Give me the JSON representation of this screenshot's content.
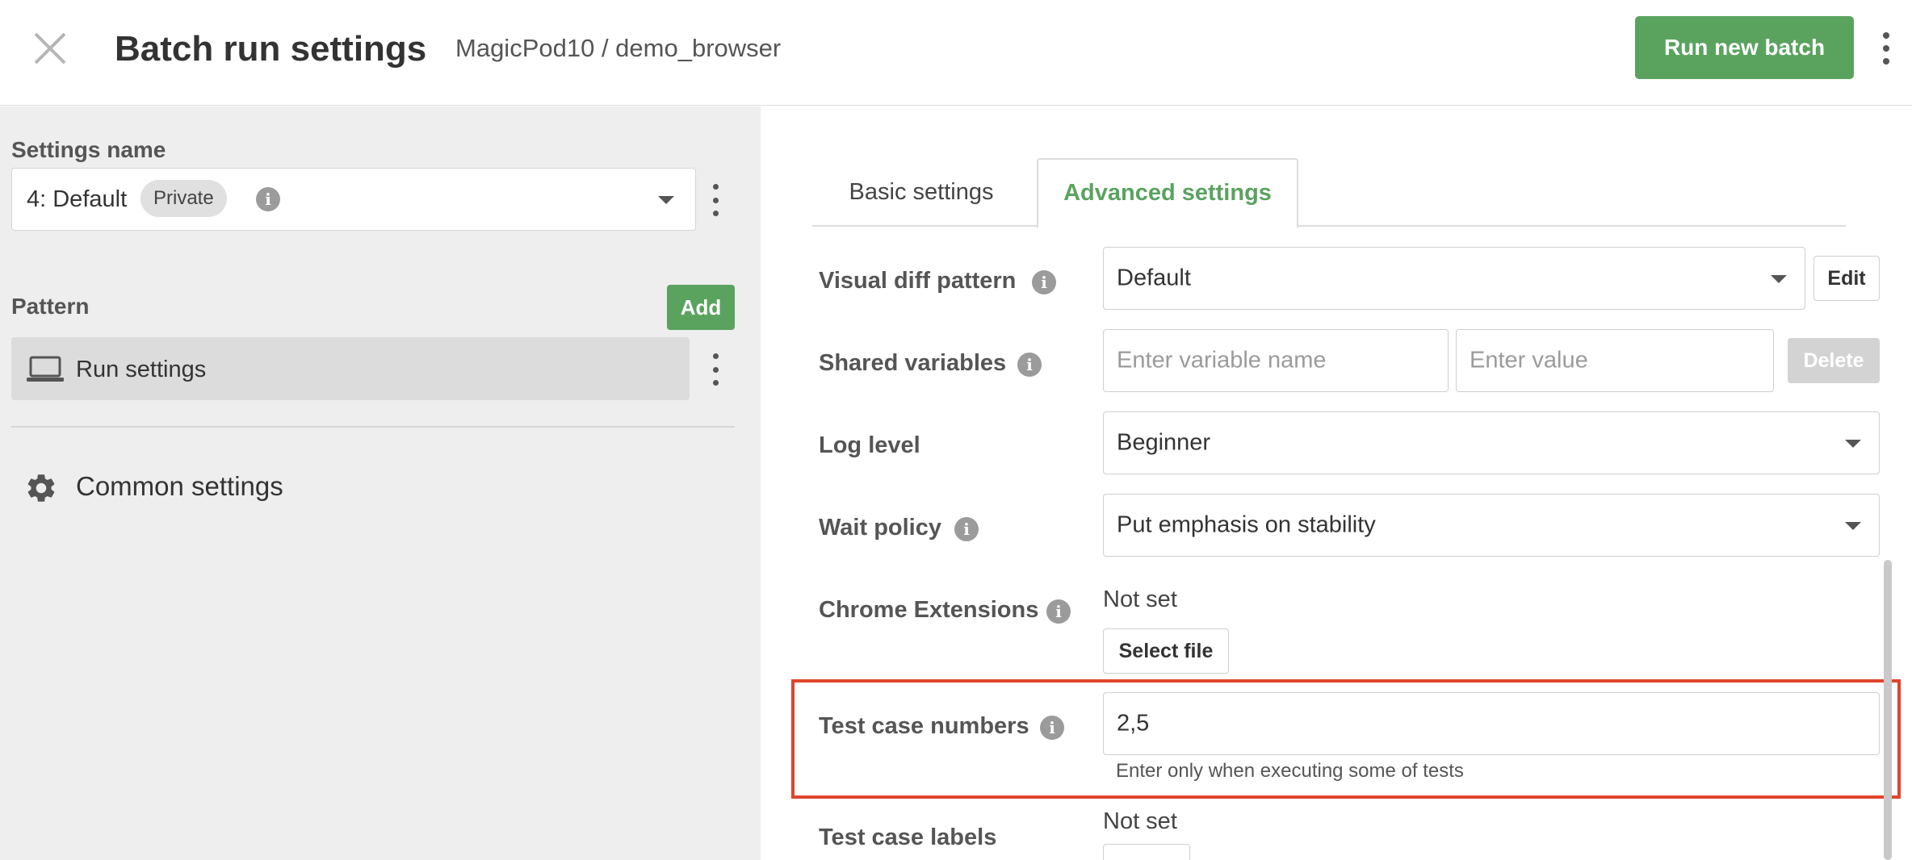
{
  "header": {
    "title": "Batch run settings",
    "breadcrumb": "MagicPod10 / demo_browser",
    "run_button": "Run new batch"
  },
  "sidebar": {
    "settings_name_label": "Settings name",
    "selected_setting": "4: Default",
    "visibility_badge": "Private",
    "pattern_label": "Pattern",
    "add_button": "Add",
    "pattern_items": [
      {
        "label": "Run settings",
        "icon": "laptop-icon"
      }
    ],
    "common_settings": {
      "label": "Common settings",
      "icon": "gear-icon"
    }
  },
  "tabs": [
    {
      "label": "Basic settings",
      "active": false
    },
    {
      "label": "Advanced settings",
      "active": true
    }
  ],
  "fields": {
    "visual_diff": {
      "label": "Visual diff pattern",
      "value": "Default",
      "edit_button": "Edit"
    },
    "shared_variables": {
      "label": "Shared variables",
      "name_placeholder": "Enter variable name",
      "value_placeholder": "Enter value",
      "delete_button": "Delete"
    },
    "log_level": {
      "label": "Log level",
      "value": "Beginner"
    },
    "wait_policy": {
      "label": "Wait policy",
      "value": "Put emphasis on stability"
    },
    "chrome_extensions": {
      "label": "Chrome Extensions",
      "status": "Not set",
      "select_button": "Select file"
    },
    "test_case_numbers": {
      "label": "Test case numbers",
      "value": "2,5",
      "helper": "Enter only when executing some of tests"
    },
    "test_case_labels": {
      "label": "Test case labels",
      "status": "Not set"
    }
  },
  "colors": {
    "accent": "#5aa35f",
    "highlight": "#e0442d"
  }
}
